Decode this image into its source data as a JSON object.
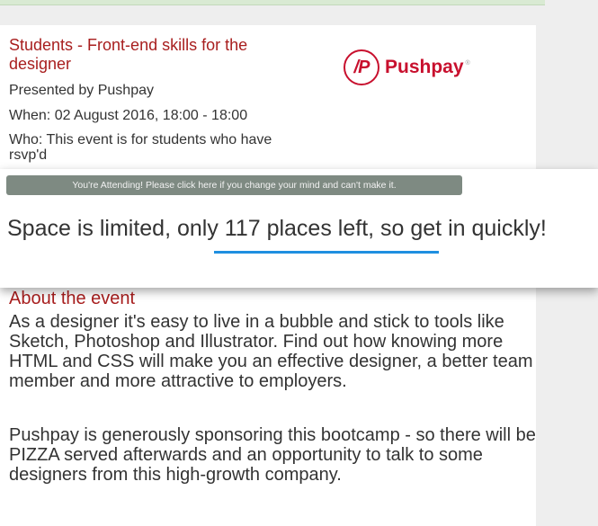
{
  "event": {
    "title": "Students - Front-end skills for the designer",
    "presented_by": "Presented by Pushpay",
    "when": "When: 02 August 2016, 18:00 - 18:00",
    "who": "Who: This event is for students who have rsvp'd"
  },
  "logo": {
    "glyph": "/P",
    "name": "Pushpay",
    "trademark": "®",
    "color": "#c8102e"
  },
  "attending": {
    "label": "You're Attending! Please click here if you change your mind and can't make it."
  },
  "availability": {
    "text": "Space is limited, only 117 places left, so get in quickly!"
  },
  "about": {
    "heading": "About the event",
    "paragraphs": [
      "As a designer it's easy to live in a bubble and stick to tools like Sketch, Photoshop and Illustrator. Find out how knowing more HTML and CSS will make you an effective designer, a better team member and more attractive to employers.",
      "Pushpay is generously sponsoring this bootcamp - so there will be PIZZA served afterwards and an opportunity to talk to some designers from this high-growth company."
    ]
  },
  "colors": {
    "title_red": "#a81e1e",
    "button_grey": "#7e8a82",
    "underline_blue": "#1e8fe0"
  }
}
